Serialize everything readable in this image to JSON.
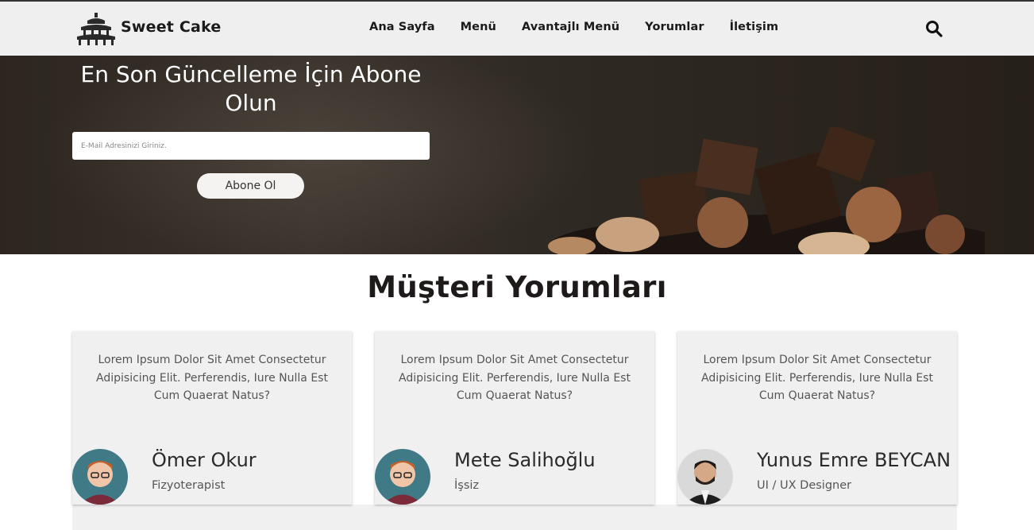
{
  "header": {
    "brand": "Sweet Cake",
    "nav": [
      "Ana Sayfa",
      "Menü",
      "Avantajlı Menü",
      "Yorumlar",
      "İletişim"
    ]
  },
  "hero": {
    "title": "En Son Güncelleme İçin Abone Olun",
    "email_placeholder": "E-Mail Adresinizi Giriniz.",
    "subscribe_label": "Abone Ol"
  },
  "reviews": {
    "title": "Müşteri Yorumları",
    "items": [
      {
        "text": "Lorem Ipsum Dolor Sit Amet Consectetur Adipisicing Elit. Perferendis, Iure Nulla Est Cum Quaerat Natus?",
        "name": "Ömer Okur",
        "role": "Fizyoterapist"
      },
      {
        "text": "Lorem Ipsum Dolor Sit Amet Consectetur Adipisicing Elit. Perferendis, Iure Nulla Est Cum Quaerat Natus?",
        "name": "Mete Salihoğlu",
        "role": "İşsiz"
      },
      {
        "text": "Lorem Ipsum Dolor Sit Amet Consectetur Adipisicing Elit. Perferendis, Iure Nulla Est Cum Quaerat Natus?",
        "name": "Yunus Emre BEYCAN",
        "role": "UI / UX Designer"
      }
    ]
  }
}
